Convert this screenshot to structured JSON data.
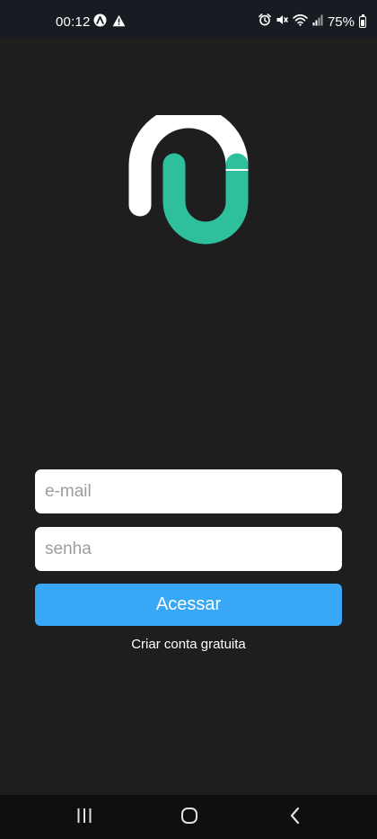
{
  "status_bar": {
    "time": "00:12",
    "battery": "75%",
    "left_icons": [
      "app-notification-icon",
      "warning-icon"
    ],
    "right_icons": [
      "alarm-icon",
      "mute-icon",
      "wifi-icon",
      "signal-icon",
      "battery-icon"
    ]
  },
  "logo": {
    "colors": {
      "left_arch": "#ffffff",
      "right_arch": "#2ec09c"
    }
  },
  "login_form": {
    "email_placeholder": "e-mail",
    "email_value": "",
    "password_placeholder": "senha",
    "password_value": "",
    "submit_label": "Acessar",
    "create_account_label": "Criar conta gratuita"
  },
  "colors": {
    "background": "#1e1e1e",
    "accent": "#38a8f6",
    "brand_green": "#2ec09c"
  },
  "nav_bar": {
    "icons": [
      "recents-icon",
      "home-icon",
      "back-icon"
    ]
  }
}
